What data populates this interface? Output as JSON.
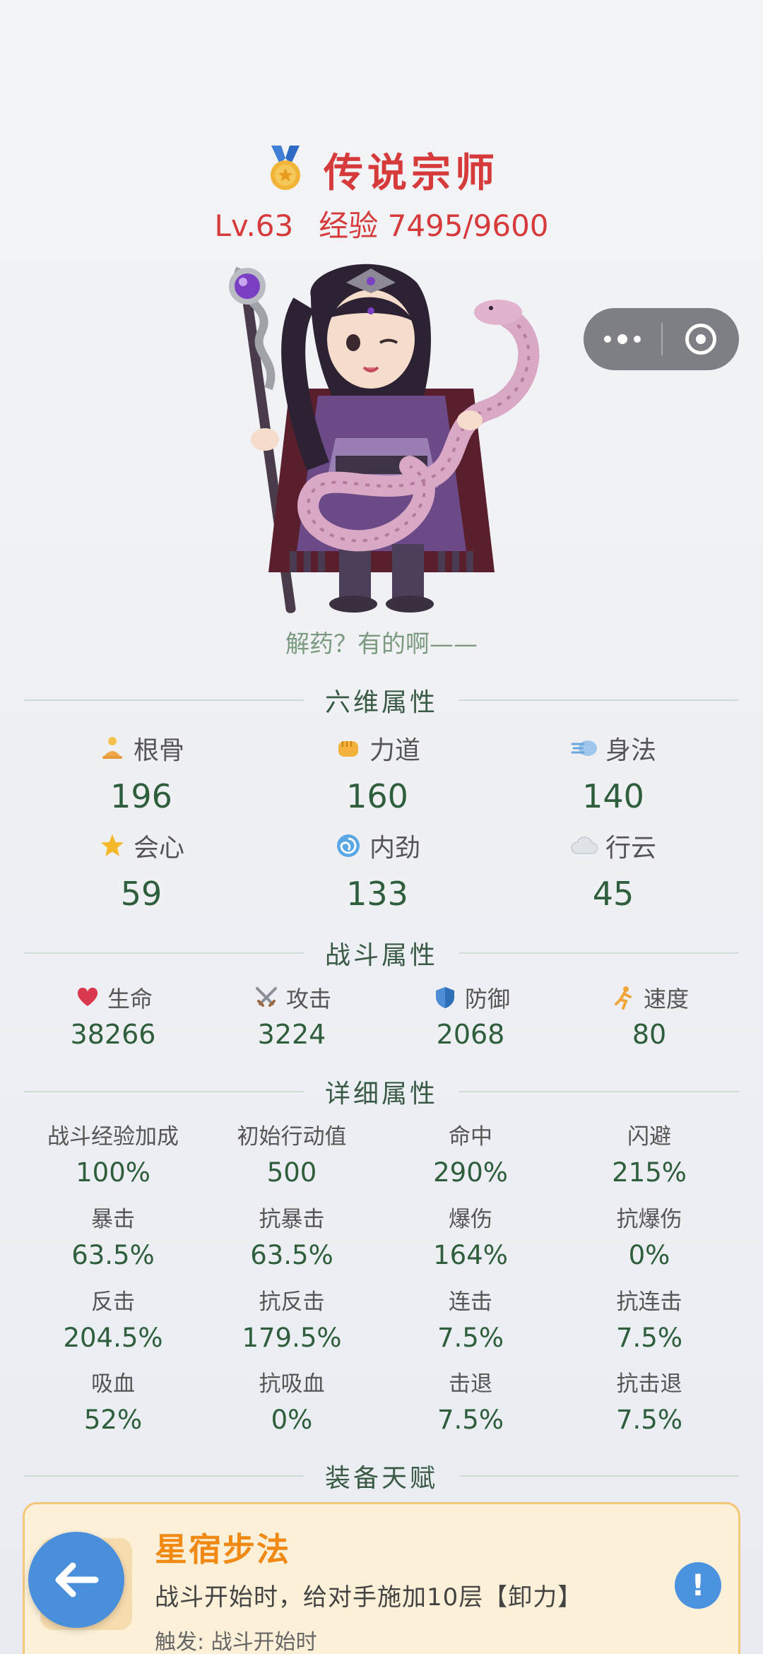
{
  "header": {
    "rank_title": "传说宗师",
    "level": "Lv.63",
    "exp": "经验 7495/9600",
    "quote": "解药？有的啊——"
  },
  "capsule": {
    "more_icon": "more-dots-icon",
    "close_icon": "target-icon"
  },
  "sections": {
    "six": "六维属性",
    "combat": "战斗属性",
    "detail": "详细属性",
    "talent": "装备天赋"
  },
  "six_stats": [
    {
      "label": "根骨",
      "value": "196",
      "icon": "meditate-icon"
    },
    {
      "label": "力道",
      "value": "160",
      "icon": "fist-icon"
    },
    {
      "label": "身法",
      "value": "140",
      "icon": "wind-icon"
    },
    {
      "label": "会心",
      "value": "59",
      "icon": "star-icon"
    },
    {
      "label": "内劲",
      "value": "133",
      "icon": "swirl-icon"
    },
    {
      "label": "行云",
      "value": "45",
      "icon": "cloud-icon"
    }
  ],
  "combat_stats": [
    {
      "label": "生命",
      "value": "38266",
      "icon": "heart-icon"
    },
    {
      "label": "攻击",
      "value": "3224",
      "icon": "swords-icon"
    },
    {
      "label": "防御",
      "value": "2068",
      "icon": "shield-icon"
    },
    {
      "label": "速度",
      "value": "80",
      "icon": "runner-icon"
    }
  ],
  "detail_stats": [
    {
      "label": "战斗经验加成",
      "value": "100%"
    },
    {
      "label": "初始行动值",
      "value": "500"
    },
    {
      "label": "命中",
      "value": "290%"
    },
    {
      "label": "闪避",
      "value": "215%"
    },
    {
      "label": "暴击",
      "value": "63.5%"
    },
    {
      "label": "抗暴击",
      "value": "63.5%"
    },
    {
      "label": "爆伤",
      "value": "164%"
    },
    {
      "label": "抗爆伤",
      "value": "0%"
    },
    {
      "label": "反击",
      "value": "204.5%"
    },
    {
      "label": "抗反击",
      "value": "179.5%"
    },
    {
      "label": "连击",
      "value": "7.5%"
    },
    {
      "label": "抗连击",
      "value": "7.5%"
    },
    {
      "label": "吸血",
      "value": "52%"
    },
    {
      "label": "抗吸血",
      "value": "0%"
    },
    {
      "label": "击退",
      "value": "7.5%"
    },
    {
      "label": "抗击退",
      "value": "7.5%"
    }
  ],
  "talent": {
    "name": "星宿步法",
    "desc": "战斗开始时，给对手施加10层【卸力】",
    "trigger": "触发: 战斗开始时",
    "info_icon": "!"
  },
  "colors": {
    "rank_red": "#d63a3a",
    "stat_green": "#2e5e3b",
    "talent_orange": "#f08a14",
    "accent_blue": "#4a8fdc"
  }
}
